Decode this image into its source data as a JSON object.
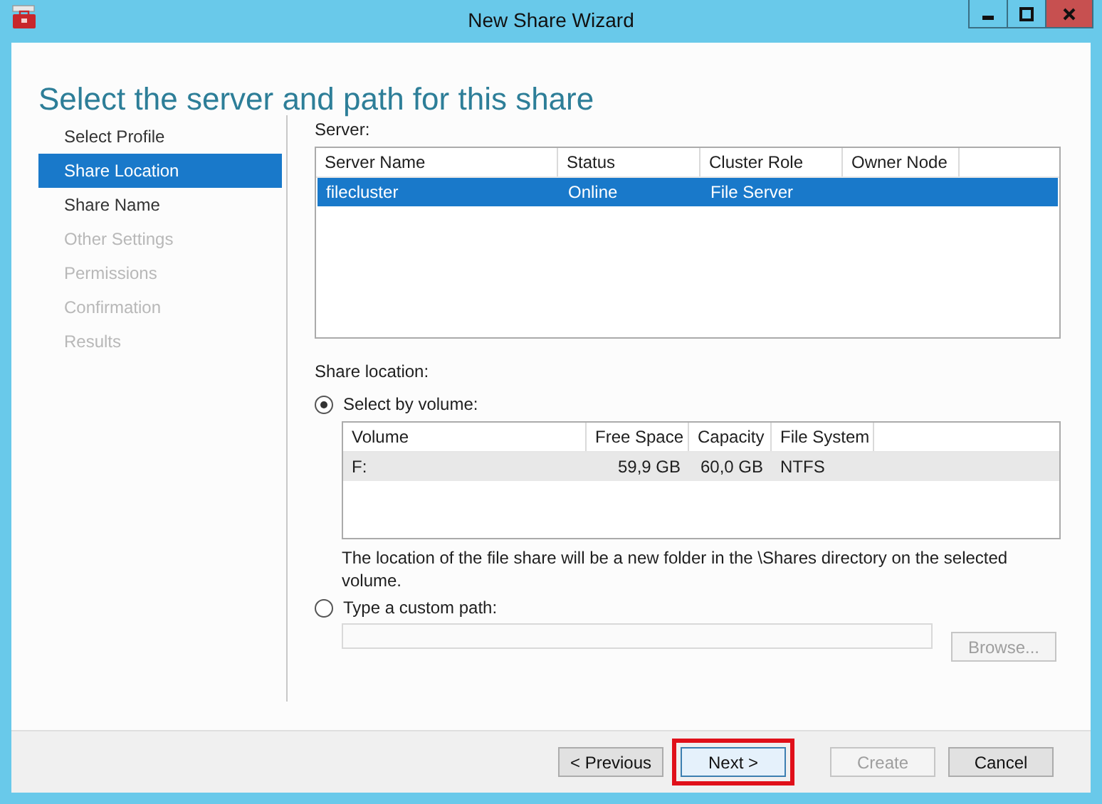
{
  "window": {
    "title": "New Share Wizard"
  },
  "heading": "Select the server and path for this share",
  "steps": [
    {
      "label": "Select Profile",
      "selected": false,
      "disabled": false
    },
    {
      "label": "Share Location",
      "selected": true,
      "disabled": false
    },
    {
      "label": "Share Name",
      "selected": false,
      "disabled": false
    },
    {
      "label": "Other Settings",
      "selected": false,
      "disabled": true
    },
    {
      "label": "Permissions",
      "selected": false,
      "disabled": true
    },
    {
      "label": "Confirmation",
      "selected": false,
      "disabled": true
    },
    {
      "label": "Results",
      "selected": false,
      "disabled": true
    }
  ],
  "server": {
    "label": "Server:",
    "columns": [
      "Server Name",
      "Status",
      "Cluster Role",
      "Owner Node"
    ],
    "rows": [
      {
        "cells": [
          "filecluster",
          "Online",
          "File Server",
          ""
        ],
        "selected": true
      }
    ]
  },
  "share_location": {
    "label": "Share location:",
    "by_volume": {
      "label": "Select by volume:",
      "selected": true
    },
    "volumes": {
      "columns": [
        "Volume",
        "Free Space",
        "Capacity",
        "File System"
      ],
      "rows": [
        {
          "cells": [
            "F:",
            "59,9 GB",
            "60,0 GB",
            "NTFS"
          ],
          "selected": true
        }
      ]
    },
    "note": "The location of the file share will be a new folder in the \\Shares directory on the selected volume.",
    "custom_path": {
      "label": "Type a custom path:",
      "selected": false,
      "disabled": true
    },
    "browse": {
      "label": "Browse...",
      "disabled": true
    }
  },
  "buttons": [
    {
      "label": "< Previous",
      "disabled": false,
      "default": false,
      "highlighted": false
    },
    {
      "label": "Next >",
      "disabled": false,
      "default": true,
      "highlighted": true
    },
    {
      "label": "Create",
      "disabled": true,
      "default": false,
      "highlighted": false
    },
    {
      "label": "Cancel",
      "disabled": false,
      "default": false,
      "highlighted": false
    }
  ]
}
